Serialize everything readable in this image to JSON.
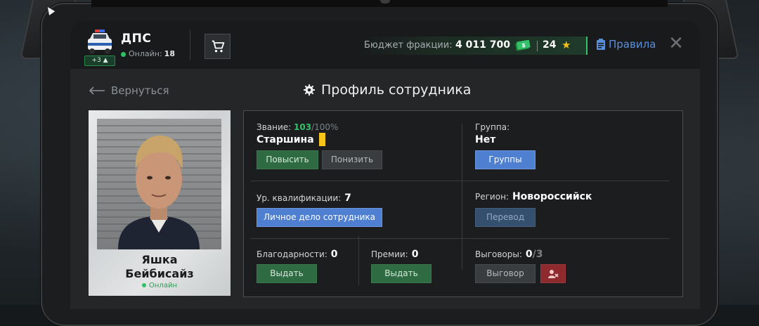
{
  "header": {
    "faction_name": "ДПС",
    "online_label": "Онлайн:",
    "online_count": "18",
    "badge": "+3",
    "budget_label": "Бюджет фракции:",
    "budget_value": "4 011 700",
    "stars_value": "24",
    "rules_label": "Правила"
  },
  "nav": {
    "back_label": "Вернуться",
    "page_title": "Профиль сотрудника"
  },
  "profile": {
    "name_line1": "Яшка",
    "name_line2": "Бейбисайз",
    "status": "Онлайн"
  },
  "panel": {
    "rank_label": "Звание:",
    "rank_progress": "103",
    "rank_progress_max": "/100%",
    "rank_name": "Старшина",
    "promote_label": "Повысить",
    "demote_label": "Понизить",
    "group_label": "Группа:",
    "group_value": "Нет",
    "groups_button": "Группы",
    "qualification_label": "Ур. квалификации:",
    "qualification_value": "7",
    "personal_file_button": "Личное дело сотрудника",
    "region_label": "Регион:",
    "region_value": "Новороссийск",
    "transfer_button": "Перевод",
    "thanks_label": "Благодарности:",
    "thanks_value": "0",
    "thanks_button": "Выдать",
    "bonuses_label": "Премии:",
    "bonuses_value": "0",
    "bonuses_button": "Выдать",
    "reprimands_label": "Выговоры:",
    "reprimands_value": "0",
    "reprimands_max": "/3",
    "reprimand_button": "Выговор"
  },
  "colors": {
    "accent_green": "#35c06a",
    "accent_blue": "#4f7fd0",
    "star_yellow": "#f5c018",
    "danger_red": "#8e2a2e"
  },
  "icons": [
    "police-car-icon",
    "cart-icon",
    "money-icon",
    "star-icon",
    "clipboard-icon",
    "close-icon",
    "arrow-left-icon",
    "gear-icon",
    "remove-user-icon"
  ]
}
